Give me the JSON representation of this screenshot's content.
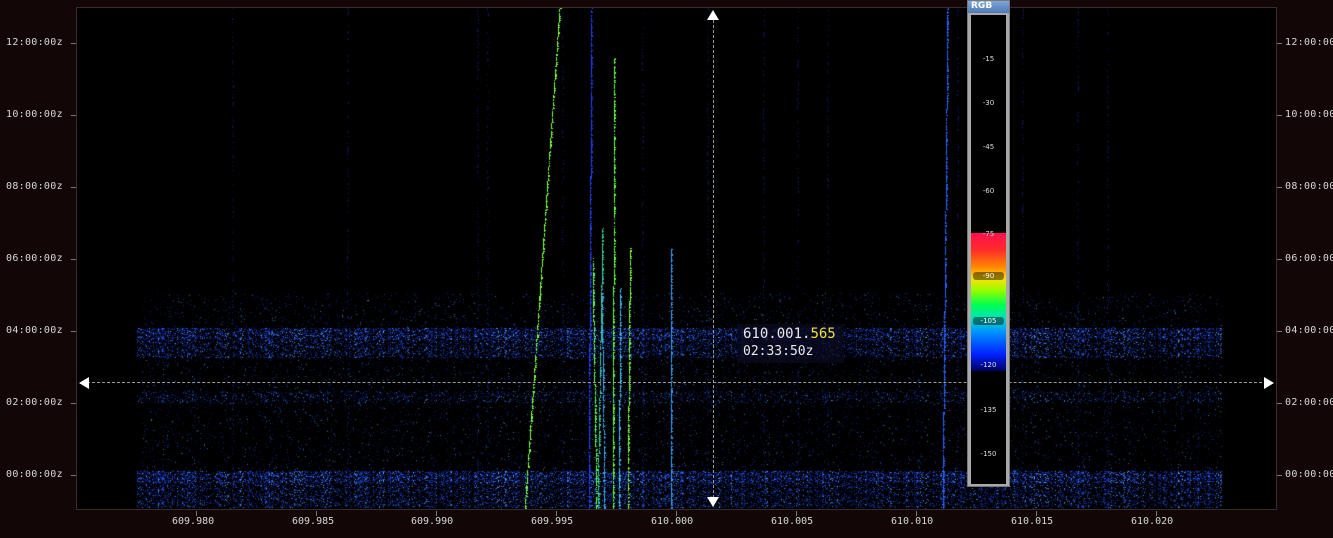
{
  "time_axis": {
    "labels": [
      "12:00:00z",
      "10:00:00z",
      "08:00:00z",
      "06:00:00z",
      "04:00:00z",
      "02:00:00z",
      "00:00:00z"
    ]
  },
  "freq_axis": {
    "labels": [
      "609.980",
      "609.985",
      "609.990",
      "609.995",
      "610.000",
      "610.005",
      "610.010",
      "610.015",
      "610.020"
    ]
  },
  "cursor_readout": {
    "freq_main": "610.001.",
    "freq_hz": "565",
    "time": "02:33:50z"
  },
  "color_legend": {
    "title": "RGB",
    "levels": [
      "-15",
      "-30",
      "-45",
      "-60",
      "-75",
      "-90",
      "-105",
      "-120",
      "-135",
      "-150"
    ]
  },
  "colors": {
    "background": "#120606",
    "plot_bg": "#000000",
    "signal_blue": "#1a3cff",
    "readout_hz": "#f0e040"
  }
}
